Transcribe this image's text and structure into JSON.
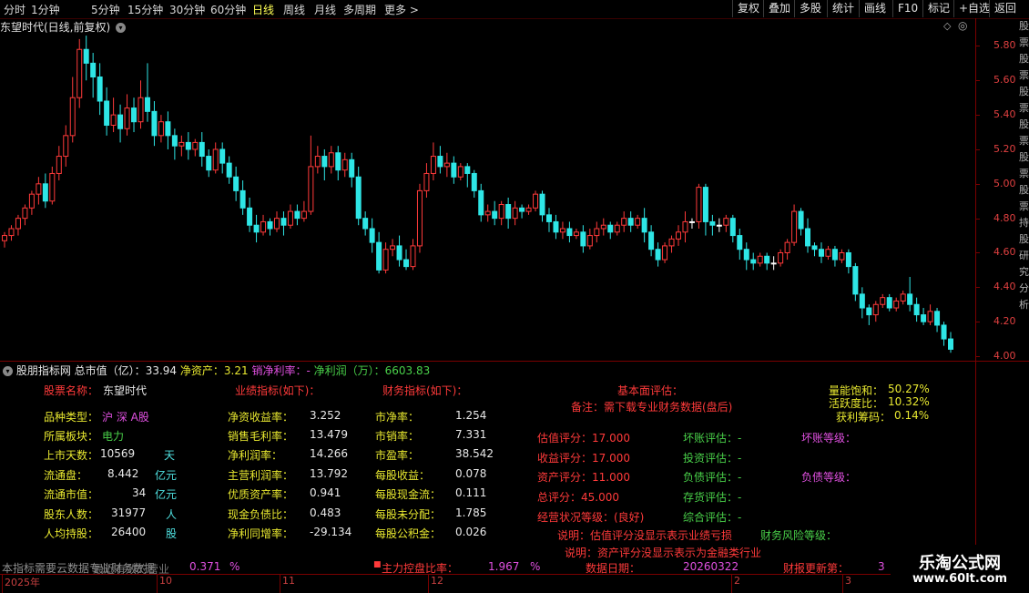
{
  "period_tabs": [
    "分时",
    "1分钟",
    "5分钟",
    "15分钟",
    "30分钟",
    "60分钟",
    "日线",
    "周线",
    "月线",
    "多周期",
    "更多 >"
  ],
  "active_tab": "日线",
  "toolbar": [
    "复权",
    "叠加",
    "多股",
    "统计",
    "画线",
    "F10",
    "标记",
    "+自选",
    "返回"
  ],
  "chart_title": "东望时代(日线,前复权)",
  "sidestrip_text": "股票股票股票股票股票股票持股研究分析",
  "chart_data": {
    "type": "candlestick",
    "title": "东望时代(日线,前复权)",
    "ylim": [
      4.0,
      5.85
    ],
    "y_ticks": [
      "5.80",
      "5.60",
      "5.40",
      "5.20",
      "5.00",
      "4.80",
      "4.60",
      "4.40",
      "4.20",
      "4.00"
    ],
    "x_ticks": [
      "2025年",
      "10",
      "11",
      "12",
      "2",
      "3"
    ],
    "colors": {
      "up": "#ff3a3a",
      "down": "#2ee6e6",
      "flat": "#ffffff"
    },
    "candles": [
      [
        4.67,
        4.7,
        4.63,
        4.72
      ],
      [
        4.7,
        4.74,
        4.67,
        4.76
      ],
      [
        4.74,
        4.8,
        4.7,
        4.82
      ],
      [
        4.8,
        4.86,
        4.76,
        4.88
      ],
      [
        4.86,
        4.94,
        4.82,
        4.96
      ],
      [
        4.94,
        5.0,
        4.88,
        5.04
      ],
      [
        5.0,
        4.9,
        4.86,
        5.06
      ],
      [
        4.9,
        5.06,
        4.88,
        5.1
      ],
      [
        5.06,
        5.16,
        5.02,
        5.22
      ],
      [
        5.16,
        5.28,
        5.1,
        5.34
      ],
      [
        5.28,
        5.5,
        5.24,
        5.62
      ],
      [
        5.5,
        5.78,
        5.44,
        5.84
      ],
      [
        5.78,
        5.7,
        5.6,
        5.86
      ],
      [
        5.7,
        5.62,
        5.5,
        5.76
      ],
      [
        5.62,
        5.48,
        5.4,
        5.7
      ],
      [
        5.48,
        5.34,
        5.28,
        5.56
      ],
      [
        5.34,
        5.4,
        5.3,
        5.5
      ],
      [
        5.4,
        5.32,
        5.24,
        5.46
      ],
      [
        5.32,
        5.44,
        5.28,
        5.52
      ],
      [
        5.44,
        5.36,
        5.3,
        5.5
      ],
      [
        5.36,
        5.5,
        5.32,
        5.6
      ],
      [
        5.5,
        5.42,
        5.36,
        5.7
      ],
      [
        5.42,
        5.28,
        5.22,
        5.48
      ],
      [
        5.28,
        5.36,
        5.24,
        5.4
      ],
      [
        5.36,
        5.28,
        5.2,
        5.42
      ],
      [
        5.28,
        5.22,
        5.14,
        5.32
      ],
      [
        5.22,
        5.24,
        5.16,
        5.28
      ],
      [
        5.24,
        5.2,
        5.14,
        5.3
      ],
      [
        5.2,
        5.24,
        5.16,
        5.26
      ],
      [
        5.24,
        5.16,
        5.1,
        5.3
      ],
      [
        5.16,
        5.08,
        5.04,
        5.2
      ],
      [
        5.08,
        5.2,
        5.06,
        5.24
      ],
      [
        5.2,
        5.12,
        5.06,
        5.24
      ],
      [
        5.12,
        5.04,
        5.0,
        5.16
      ],
      [
        5.04,
        4.96,
        4.9,
        5.1
      ],
      [
        4.96,
        4.86,
        4.82,
        5.02
      ],
      [
        4.86,
        4.76,
        4.72,
        4.92
      ],
      [
        4.76,
        4.72,
        4.66,
        4.82
      ],
      [
        4.72,
        4.78,
        4.7,
        4.82
      ],
      [
        4.78,
        4.74,
        4.7,
        4.8
      ],
      [
        4.74,
        4.8,
        4.72,
        4.84
      ],
      [
        4.8,
        4.76,
        4.7,
        4.84
      ],
      [
        4.76,
        4.84,
        4.74,
        4.88
      ],
      [
        4.84,
        4.8,
        4.76,
        4.88
      ],
      [
        4.8,
        4.84,
        4.78,
        4.9
      ],
      [
        4.84,
        5.1,
        4.82,
        5.28
      ],
      [
        5.1,
        5.16,
        5.06,
        5.22
      ],
      [
        5.16,
        5.1,
        5.02,
        5.2
      ],
      [
        5.1,
        5.18,
        5.06,
        5.22
      ],
      [
        5.18,
        5.08,
        5.02,
        5.22
      ],
      [
        5.08,
        5.14,
        5.04,
        5.18
      ],
      [
        5.14,
        5.04,
        4.98,
        5.18
      ],
      [
        5.04,
        4.8,
        4.76,
        5.1
      ],
      [
        4.8,
        4.74,
        4.7,
        4.84
      ],
      [
        4.74,
        4.66,
        4.6,
        4.8
      ],
      [
        4.66,
        4.5,
        4.48,
        4.72
      ],
      [
        4.5,
        4.62,
        4.48,
        4.66
      ],
      [
        4.62,
        4.64,
        4.58,
        4.68
      ],
      [
        4.64,
        4.56,
        4.52,
        4.7
      ],
      [
        4.56,
        4.52,
        4.5,
        4.62
      ],
      [
        4.52,
        4.64,
        4.5,
        4.68
      ],
      [
        4.64,
        4.96,
        4.6,
        5.0
      ],
      [
        4.96,
        5.06,
        4.92,
        5.12
      ],
      [
        5.06,
        5.16,
        5.02,
        5.24
      ],
      [
        5.16,
        5.1,
        5.06,
        5.22
      ],
      [
        5.1,
        5.12,
        5.04,
        5.18
      ],
      [
        5.12,
        5.04,
        5.0,
        5.16
      ],
      [
        5.04,
        5.1,
        5.02,
        5.12
      ],
      [
        5.1,
        5.06,
        4.98,
        5.12
      ],
      [
        5.06,
        4.96,
        4.92,
        5.08
      ],
      [
        4.96,
        4.82,
        4.78,
        5.0
      ],
      [
        4.82,
        4.84,
        4.78,
        4.88
      ],
      [
        4.84,
        4.8,
        4.76,
        4.9
      ],
      [
        4.8,
        4.88,
        4.76,
        4.9
      ],
      [
        4.88,
        4.8,
        4.74,
        4.92
      ],
      [
        4.8,
        4.86,
        4.76,
        4.9
      ],
      [
        4.86,
        4.84,
        4.8,
        4.88
      ],
      [
        4.84,
        4.86,
        4.82,
        4.88
      ],
      [
        4.86,
        4.94,
        4.84,
        4.96
      ],
      [
        4.94,
        4.82,
        4.78,
        4.96
      ],
      [
        4.82,
        4.78,
        4.72,
        4.86
      ],
      [
        4.78,
        4.72,
        4.68,
        4.82
      ],
      [
        4.72,
        4.74,
        4.68,
        4.78
      ],
      [
        4.74,
        4.7,
        4.66,
        4.78
      ],
      [
        4.7,
        4.72,
        4.68,
        4.74
      ],
      [
        4.72,
        4.64,
        4.6,
        4.76
      ],
      [
        4.64,
        4.7,
        4.62,
        4.74
      ],
      [
        4.7,
        4.74,
        4.66,
        4.78
      ],
      [
        4.74,
        4.76,
        4.7,
        4.8
      ],
      [
        4.76,
        4.72,
        4.68,
        4.78
      ],
      [
        4.72,
        4.76,
        4.7,
        4.78
      ],
      [
        4.76,
        4.8,
        4.72,
        4.84
      ],
      [
        4.8,
        4.76,
        4.72,
        4.84
      ],
      [
        4.76,
        4.8,
        4.74,
        4.82
      ],
      [
        4.8,
        4.72,
        4.66,
        4.86
      ],
      [
        4.72,
        4.62,
        4.58,
        4.76
      ],
      [
        4.62,
        4.56,
        4.52,
        4.66
      ],
      [
        4.56,
        4.64,
        4.54,
        4.66
      ],
      [
        4.64,
        4.68,
        4.6,
        4.7
      ],
      [
        4.68,
        4.72,
        4.64,
        4.76
      ],
      [
        4.72,
        4.78,
        4.66,
        4.84
      ],
      [
        4.78,
        4.78,
        4.74,
        4.8
      ],
      [
        4.78,
        4.98,
        4.74,
        5.0
      ],
      [
        4.98,
        4.78,
        4.7,
        5.0
      ],
      [
        4.78,
        4.76,
        4.7,
        4.82
      ],
      [
        4.76,
        4.76,
        4.72,
        4.8
      ],
      [
        4.76,
        4.8,
        4.72,
        4.82
      ],
      [
        4.8,
        4.7,
        4.66,
        4.82
      ],
      [
        4.7,
        4.62,
        4.56,
        4.74
      ],
      [
        4.62,
        4.56,
        4.5,
        4.66
      ],
      [
        4.56,
        4.54,
        4.5,
        4.6
      ],
      [
        4.54,
        4.58,
        4.52,
        4.6
      ],
      [
        4.58,
        4.54,
        4.5,
        4.6
      ],
      [
        4.54,
        4.54,
        4.5,
        4.58
      ],
      [
        4.54,
        4.6,
        4.52,
        4.62
      ],
      [
        4.6,
        4.66,
        4.56,
        4.68
      ],
      [
        4.66,
        4.84,
        4.64,
        4.88
      ],
      [
        4.84,
        4.74,
        4.7,
        4.86
      ],
      [
        4.74,
        4.64,
        4.6,
        4.8
      ],
      [
        4.64,
        4.62,
        4.58,
        4.66
      ],
      [
        4.62,
        4.58,
        4.54,
        4.66
      ],
      [
        4.58,
        4.62,
        4.56,
        4.64
      ],
      [
        4.62,
        4.56,
        4.52,
        4.64
      ],
      [
        4.56,
        4.6,
        4.54,
        4.62
      ],
      [
        4.6,
        4.52,
        4.48,
        4.62
      ],
      [
        4.52,
        4.36,
        4.32,
        4.54
      ],
      [
        4.36,
        4.28,
        4.22,
        4.4
      ],
      [
        4.28,
        4.24,
        4.18,
        4.3
      ],
      [
        4.24,
        4.3,
        4.2,
        4.32
      ],
      [
        4.3,
        4.34,
        4.28,
        4.36
      ],
      [
        4.34,
        4.28,
        4.26,
        4.36
      ],
      [
        4.28,
        4.32,
        4.26,
        4.34
      ],
      [
        4.32,
        4.36,
        4.3,
        4.38
      ],
      [
        4.36,
        4.3,
        4.26,
        4.46
      ],
      [
        4.3,
        4.24,
        4.2,
        4.34
      ],
      [
        4.24,
        4.2,
        4.18,
        4.28
      ],
      [
        4.2,
        4.26,
        4.18,
        4.3
      ],
      [
        4.26,
        4.18,
        4.14,
        4.28
      ],
      [
        4.18,
        4.1,
        4.06,
        4.2
      ],
      [
        4.1,
        4.04,
        4.02,
        4.14
      ]
    ]
  },
  "indicator": {
    "title": "股朋指标网",
    "mcap_label": "总市值（亿）：",
    "mcap_value": "33.94",
    "net_assets_label": "净资产：",
    "net_assets_value": "3.21",
    "net_margin_label": "销净利率：",
    "net_margin_value": "-",
    "net_profit_label": "净利润（万）：",
    "net_profit_value": "6603.83"
  },
  "panel": {
    "stock_name_label": "股票名称：",
    "stock_name": "东望时代",
    "perf_header": "业绩指标(如下)：",
    "fin_header": "财务指标(如下)：",
    "fund_header": "基本面评估：",
    "fund_note": "备注：需下载专业财务数据(盘后)",
    "vol_sat_label": "量能饱和：",
    "vol_sat_value": "50.27%",
    "activity_label": "活跃度比：",
    "activity_value": "10.32%",
    "profit_chip_label": "获利筹码：",
    "profit_chip_value": "0.14%",
    "left_rows": [
      {
        "label": "品种类型：",
        "value": "沪 深 A股",
        "unit": ""
      },
      {
        "label": "所属板块：",
        "value": "电力",
        "unit": ""
      },
      {
        "label": "上市天数：",
        "value": "10569",
        "unit": "天"
      },
      {
        "label": "流通盘：",
        "value": "8.442",
        "unit": "亿元"
      },
      {
        "label": "流通市值：",
        "value": "34",
        "unit": "亿元"
      },
      {
        "label": "股东人数：",
        "value": "31977",
        "unit": "人"
      },
      {
        "label": "人均持股：",
        "value": "26400",
        "unit": "股"
      }
    ],
    "perf_rows": [
      {
        "label": "净资收益率：",
        "value": "3.252"
      },
      {
        "label": "销售毛利率：",
        "value": "13.479"
      },
      {
        "label": "净利润率：",
        "value": "14.266"
      },
      {
        "label": "主营利润率：",
        "value": "13.792"
      },
      {
        "label": "优质资产率：",
        "value": "0.941"
      },
      {
        "label": "现金负债比：",
        "value": "0.483"
      },
      {
        "label": "净利同增率：",
        "value": "-29.134"
      }
    ],
    "fin_rows": [
      {
        "label": "市净率：",
        "value": "1.254"
      },
      {
        "label": "市销率：",
        "value": "7.331"
      },
      {
        "label": "市盈率：",
        "value": "38.542"
      },
      {
        "label": "每股收益：",
        "value": "0.078"
      },
      {
        "label": "每股现金流：",
        "value": "0.111"
      },
      {
        "label": "每股未分配：",
        "value": "1.785"
      },
      {
        "label": "每股公积金：",
        "value": "0.026"
      }
    ],
    "scores": [
      "估值评分：17.000",
      "收益评分：17.000",
      "资产评分：11.000",
      "总评分：45.000",
      "经营状况等级：(良好)"
    ],
    "evals": [
      "坏账评估：-",
      "投资评估：-",
      "负债评估：-",
      "存货评估：-",
      "综合评估：-"
    ],
    "bad_debt_level": "坏账等级：",
    "debt_level": "负债等级：",
    "fin_risk_level": "财务风险等级：",
    "note1": "说明：估值评分没显示表示业绩亏损",
    "note2": "说明：资产评分没显示表示为金融类行业",
    "footer_prefix": "本指标需要云数据专业财务数据",
    "footer_overlap": "最近有效的营业",
    "footer_val1": "0.371",
    "footer_pct1": "%",
    "main_control_label": "主力控盘比率：",
    "main_control_value": "1.967",
    "main_control_pct": "%",
    "data_date_label": "数据日期：",
    "data_date_value": "20260322",
    "report_update_label": "财报更新第：",
    "report_update_value": "3"
  },
  "brand": {
    "name": "乐淘公式网",
    "url": "www.60lt.com"
  }
}
